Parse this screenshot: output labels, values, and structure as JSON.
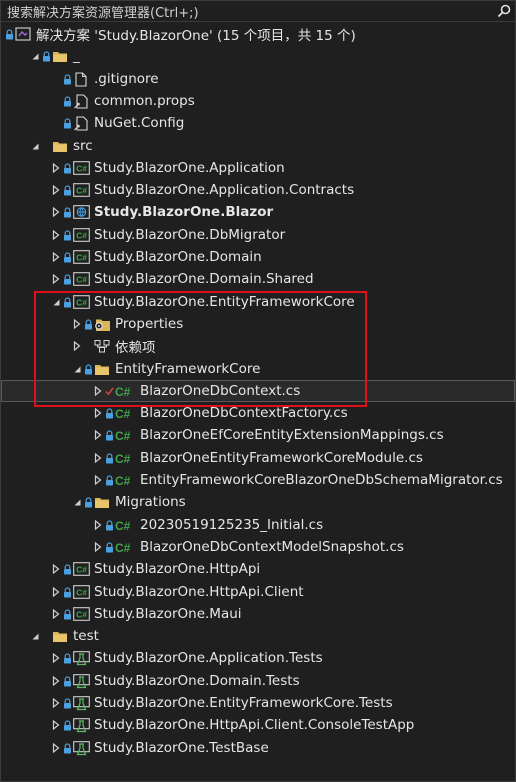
{
  "search": {
    "placeholder": "搜索解决方案资源管理器(Ctrl+;)"
  },
  "solution": {
    "label": "解决方案 'Study.BlazorOne' (15 个项目，共 15 个)"
  },
  "colors": {
    "highlight": "#e0101a",
    "folder": "#dcb45a",
    "csharp": "#3fa44a",
    "lock": "#4aa0e0"
  },
  "tree": [
    {
      "label": "_",
      "depth": 1,
      "twisty": "expanded",
      "icon": "folder",
      "lock": true
    },
    {
      "label": ".gitignore",
      "depth": 2,
      "twisty": "none",
      "icon": "file",
      "lock": true
    },
    {
      "label": "common.props",
      "depth": 2,
      "twisty": "none",
      "icon": "file-link",
      "lock": true
    },
    {
      "label": "NuGet.Config",
      "depth": 2,
      "twisty": "none",
      "icon": "file-link",
      "lock": true
    },
    {
      "label": "src",
      "depth": 1,
      "twisty": "expanded",
      "icon": "folder",
      "lock": false
    },
    {
      "label": "Study.BlazorOne.Application",
      "depth": 2,
      "twisty": "collapsed",
      "icon": "cs-project",
      "lock": true
    },
    {
      "label": "Study.BlazorOne.Application.Contracts",
      "depth": 2,
      "twisty": "collapsed",
      "icon": "cs-project",
      "lock": true
    },
    {
      "label": "Study.BlazorOne.Blazor",
      "depth": 2,
      "twisty": "collapsed",
      "icon": "web-project",
      "lock": true,
      "bold": true
    },
    {
      "label": "Study.BlazorOne.DbMigrator",
      "depth": 2,
      "twisty": "collapsed",
      "icon": "cs-project",
      "lock": true
    },
    {
      "label": "Study.BlazorOne.Domain",
      "depth": 2,
      "twisty": "collapsed",
      "icon": "cs-project",
      "lock": true
    },
    {
      "label": "Study.BlazorOne.Domain.Shared",
      "depth": 2,
      "twisty": "collapsed",
      "icon": "cs-project",
      "lock": true
    },
    {
      "label": "Study.BlazorOne.EntityFrameworkCore",
      "depth": 2,
      "twisty": "expanded",
      "icon": "cs-project",
      "lock": true
    },
    {
      "label": "Properties",
      "depth": 3,
      "twisty": "collapsed",
      "icon": "properties",
      "lock": true
    },
    {
      "label": "依赖项",
      "depth": 3,
      "twisty": "collapsed",
      "icon": "dependencies",
      "lock": false
    },
    {
      "label": "EntityFrameworkCore",
      "depth": 3,
      "twisty": "expanded",
      "icon": "folder",
      "lock": true
    },
    {
      "label": "BlazorOneDbContext.cs",
      "depth": 4,
      "twisty": "collapsed",
      "icon": "cs-file",
      "lock": false,
      "check": true,
      "selected": true
    },
    {
      "label": "BlazorOneDbContextFactory.cs",
      "depth": 4,
      "twisty": "collapsed",
      "icon": "cs-file",
      "lock": true
    },
    {
      "label": "BlazorOneEfCoreEntityExtensionMappings.cs",
      "depth": 4,
      "twisty": "collapsed",
      "icon": "cs-file",
      "lock": true
    },
    {
      "label": "BlazorOneEntityFrameworkCoreModule.cs",
      "depth": 4,
      "twisty": "collapsed",
      "icon": "cs-file",
      "lock": true
    },
    {
      "label": "EntityFrameworkCoreBlazorOneDbSchemaMigrator.cs",
      "depth": 4,
      "twisty": "collapsed",
      "icon": "cs-file",
      "lock": true
    },
    {
      "label": "Migrations",
      "depth": 3,
      "twisty": "expanded",
      "icon": "folder",
      "lock": true
    },
    {
      "label": "20230519125235_Initial.cs",
      "depth": 4,
      "twisty": "collapsed",
      "icon": "cs-file",
      "lock": true
    },
    {
      "label": "BlazorOneDbContextModelSnapshot.cs",
      "depth": 4,
      "twisty": "collapsed",
      "icon": "cs-file",
      "lock": true
    },
    {
      "label": "Study.BlazorOne.HttpApi",
      "depth": 2,
      "twisty": "collapsed",
      "icon": "cs-project",
      "lock": true
    },
    {
      "label": "Study.BlazorOne.HttpApi.Client",
      "depth": 2,
      "twisty": "collapsed",
      "icon": "cs-project",
      "lock": true
    },
    {
      "label": "Study.BlazorOne.Maui",
      "depth": 2,
      "twisty": "collapsed",
      "icon": "cs-project",
      "lock": true
    },
    {
      "label": "test",
      "depth": 1,
      "twisty": "expanded",
      "icon": "folder",
      "lock": false
    },
    {
      "label": "Study.BlazorOne.Application.Tests",
      "depth": 2,
      "twisty": "collapsed",
      "icon": "test-project",
      "lock": true
    },
    {
      "label": "Study.BlazorOne.Domain.Tests",
      "depth": 2,
      "twisty": "collapsed",
      "icon": "test-project",
      "lock": true
    },
    {
      "label": "Study.BlazorOne.EntityFrameworkCore.Tests",
      "depth": 2,
      "twisty": "collapsed",
      "icon": "test-project",
      "lock": true
    },
    {
      "label": "Study.BlazorOne.HttpApi.Client.ConsoleTestApp",
      "depth": 2,
      "twisty": "collapsed",
      "icon": "test-project",
      "lock": true
    },
    {
      "label": "Study.BlazorOne.TestBase",
      "depth": 2,
      "twisty": "collapsed",
      "icon": "test-project",
      "lock": true
    }
  ]
}
